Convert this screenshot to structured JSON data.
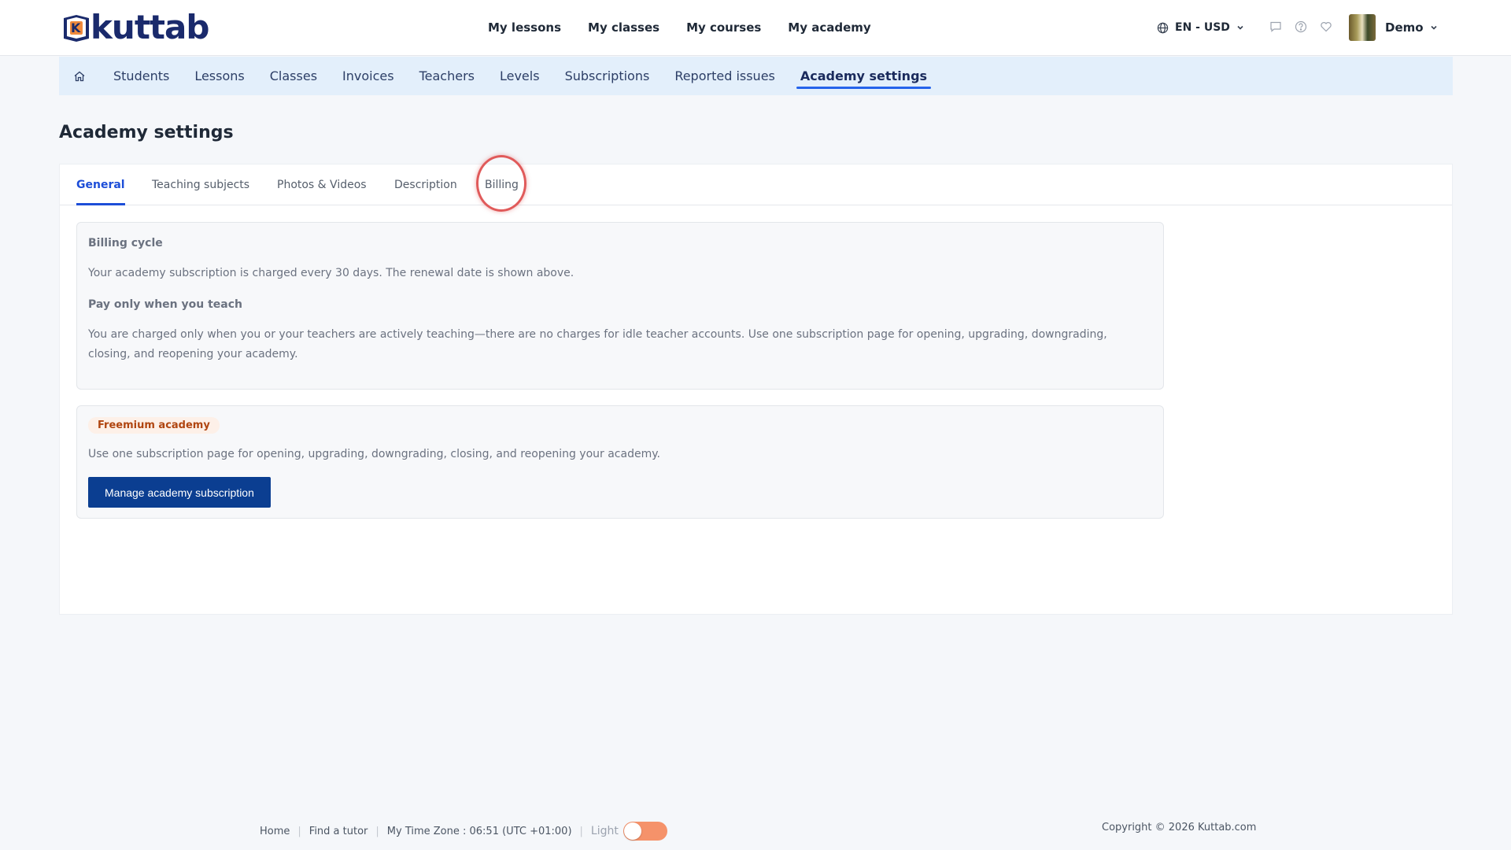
{
  "header": {
    "logo_text": "kuttab",
    "logo_mark_letter": "K",
    "nav": [
      "My lessons",
      "My classes",
      "My courses",
      "My academy"
    ],
    "language_currency": "EN - USD",
    "user_name": "Demo",
    "icons": [
      "globe-icon",
      "chat-icon",
      "help-icon",
      "heart-icon",
      "chevron-down-icon"
    ]
  },
  "subnav": {
    "items": [
      "Students",
      "Lessons",
      "Classes",
      "Invoices",
      "Teachers",
      "Levels",
      "Subscriptions",
      "Reported issues",
      "Academy settings"
    ],
    "active": "Academy settings"
  },
  "page": {
    "title": "Academy settings"
  },
  "tabs": {
    "items": [
      "General",
      "Teaching subjects",
      "Photos & Videos",
      "Description",
      "Billing"
    ],
    "active": "General",
    "highlighted": "Billing"
  },
  "billing_info": {
    "cycle_heading": "Billing cycle",
    "cycle_text": "Your academy subscription is charged every 30 days. The renewal date is shown above.",
    "pay_heading": "Pay only when you teach",
    "pay_text": "You are charged only when you or your teachers are actively teaching—there are no charges for idle teacher accounts. Use one subscription page for opening, upgrading, downgrading, closing, and reopening your academy."
  },
  "subscription": {
    "badge": "Freemium academy",
    "text": "Use one subscription page for opening, upgrading, downgrading, closing, and reopening your academy.",
    "button": "Manage academy subscription"
  },
  "footer": {
    "links": [
      "Home",
      "Find a tutor"
    ],
    "timezone": "My Time Zone : 06:51 (UTC +01:00)",
    "theme_label": "Light",
    "copyright": "Copyright © 2026 Kuttab.com"
  },
  "colors": {
    "primary": "#0b3e91",
    "active_tab": "#1d4ed8",
    "subnav_bg": "#e3effb",
    "badge_text": "#b04510",
    "toggle": "#f5926a",
    "highlight_ring": "#e05a5a"
  }
}
